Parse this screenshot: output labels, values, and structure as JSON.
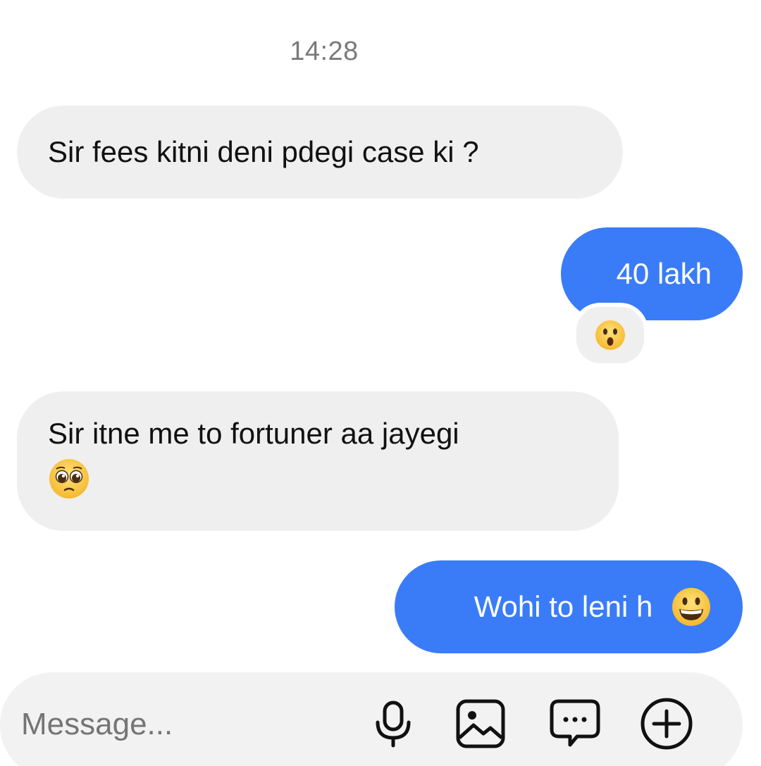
{
  "thread": {
    "timestamp": "14:28",
    "messages": [
      {
        "direction": "incoming",
        "text": "Sir fees kitni deni pdegi case ki ?"
      },
      {
        "direction": "outgoing",
        "text": "40 lakh",
        "reaction": "hushed-face"
      },
      {
        "direction": "incoming",
        "text": "Sir itne me to fortuner  aa jayegi",
        "emoji": "pleading-face"
      },
      {
        "direction": "outgoing",
        "text": "Wohi to leni h",
        "emoji": "grinning-face"
      }
    ]
  },
  "composer": {
    "placeholder": "Message...",
    "icons": [
      "microphone-icon",
      "gallery-icon",
      "sticker-icon",
      "add-icon"
    ]
  },
  "colors": {
    "outgoing_bubble": "#3a7cf7",
    "incoming_bubble": "#efefef",
    "composer_bg": "#f2f2f2",
    "timestamp": "#7a7a7a"
  }
}
